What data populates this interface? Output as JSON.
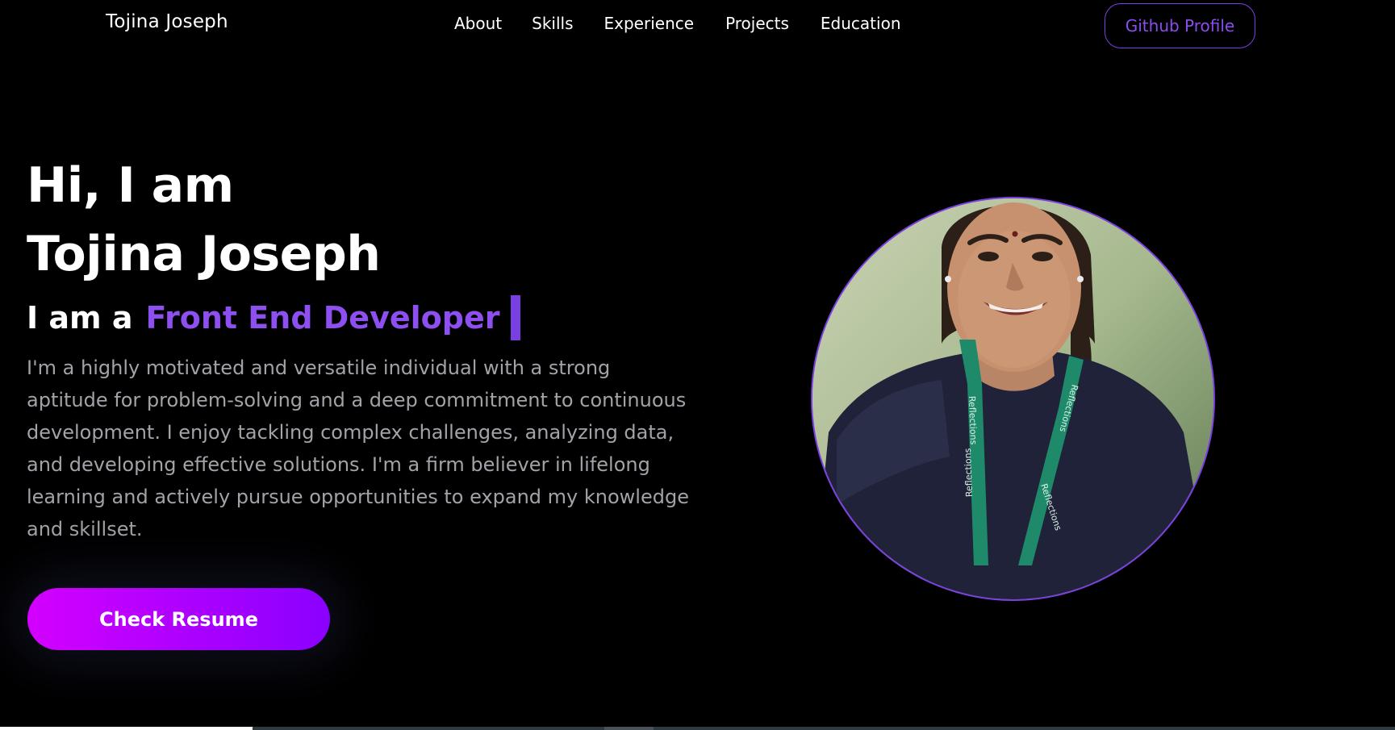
{
  "brand": "Tojina Joseph",
  "nav": {
    "links": [
      "About",
      "Skills",
      "Experience",
      "Projects",
      "Education"
    ],
    "github_label": "Github Profile"
  },
  "hero": {
    "line1": "Hi, I am",
    "line2": "Tojina Joseph",
    "role_prefix": "I am a",
    "role": "Front End Developer",
    "bio": "I'm a highly motivated and versatile individual with a strong aptitude for problem-solving and a deep commitment to continuous development. I enjoy tackling complex challenges, analyzing data, and developing effective solutions. I'm a firm believer in lifelong learning and actively pursue opportunities to expand my knowledge and skillset.",
    "resume_label": "Check Resume"
  },
  "colors": {
    "accent": "#8e4ff0",
    "button_gradient_start": "#d400ff",
    "button_gradient_end": "#8a00ff",
    "background": "#000000"
  },
  "avatar": {
    "lanyard_text": "Reflections"
  }
}
